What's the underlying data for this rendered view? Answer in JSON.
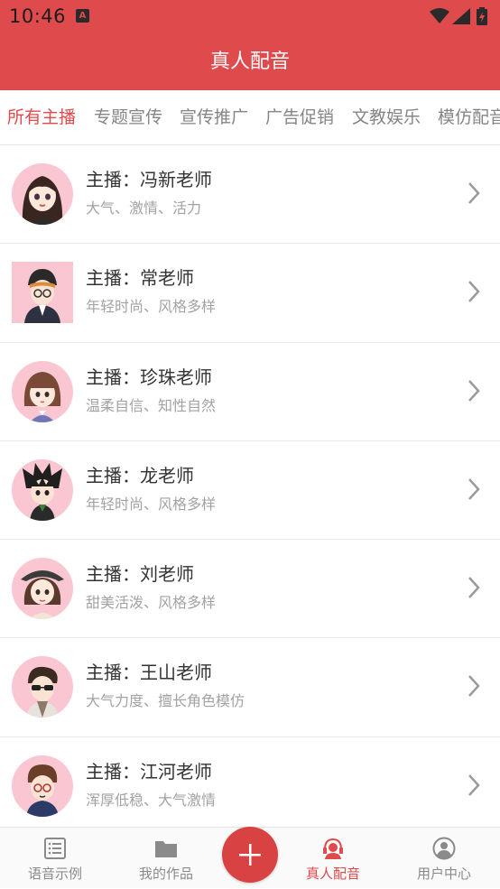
{
  "status_bar": {
    "time": "10:46",
    "notification_icon": "A"
  },
  "header": {
    "title": "真人配音"
  },
  "tabs": [
    {
      "label": "所有主播",
      "active": true
    },
    {
      "label": "专题宣传",
      "active": false
    },
    {
      "label": "宣传推广",
      "active": false
    },
    {
      "label": "广告促销",
      "active": false
    },
    {
      "label": "文教娱乐",
      "active": false
    },
    {
      "label": "模仿配音",
      "active": false
    }
  ],
  "anchors": [
    {
      "name": "主播：冯新老师",
      "desc": "大气、激情、活力",
      "avatar": "female-avatar-icon"
    },
    {
      "name": "主播：常老师",
      "desc": "年轻时尚、风格多样",
      "avatar": "male-avatar-icon"
    },
    {
      "name": "主播：珍珠老师",
      "desc": "温柔自信、知性自然",
      "avatar": "female-avatar-icon"
    },
    {
      "name": "主播：龙老师",
      "desc": "年轻时尚、风格多样",
      "avatar": "male-avatar-icon"
    },
    {
      "name": "主播：刘老师",
      "desc": "甜美活泼、风格多样",
      "avatar": "female-avatar-icon"
    },
    {
      "name": "主播：王山老师",
      "desc": "大气力度、擅长角色模仿",
      "avatar": "male-avatar-icon"
    },
    {
      "name": "主播：江河老师",
      "desc": "浑厚低稳、大气激情",
      "avatar": "male-avatar-icon"
    }
  ],
  "bottom_nav": [
    {
      "label": "语音示例",
      "icon": "list-icon",
      "active": false
    },
    {
      "label": "我的作品",
      "icon": "folder-icon",
      "active": false
    },
    {
      "label": "真人配音",
      "icon": "headset-icon",
      "active": true
    },
    {
      "label": "用户中心",
      "icon": "user-icon",
      "active": false
    }
  ],
  "fab": {
    "icon": "plus-icon"
  },
  "colors": {
    "accent": "#df4b4c",
    "avatar_bg": "#f9c6d2",
    "text_muted": "#a3a3a3"
  }
}
